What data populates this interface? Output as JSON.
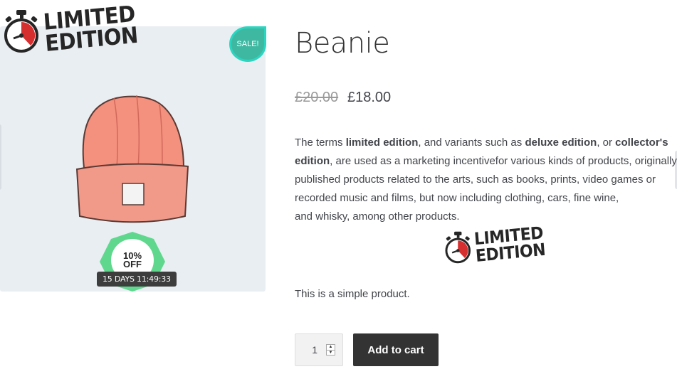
{
  "gallery": {
    "limited_badge_line1": "LIMITED",
    "limited_badge_line2": "EDITION",
    "sale_label": "SALE!",
    "discount_line1": "10%",
    "discount_line2": "OFF",
    "countdown": "15 DAYS 11:49:33"
  },
  "product": {
    "title": "Beanie",
    "price_old": "£20.00",
    "price_new": "£18.00",
    "description": {
      "p1": "The terms ",
      "b1": "limited edition",
      "p2": ", and variants such as ",
      "b2": "deluxe edition",
      "p3": ", or ",
      "b3": "collector's edition",
      "p4": ", are used as a marketing incentivefor various kinds of products, originally published products related to the arts, such as books, prints, video games or recorded music and films, but now including clothing, cars, fine wine,",
      "p5": "and whisky, among other products."
    },
    "inline_badge_line1": "LIMITED",
    "inline_badge_line2": "EDITION",
    "short_description": "This is a simple product.",
    "quantity": "1",
    "add_to_cart": "Add to cart"
  },
  "colors": {
    "sale": "#3fb8a2",
    "discount": "#5fd88e",
    "button": "#333333",
    "stopwatch_red": "#d62f2f"
  },
  "icons": [
    "stopwatch-icon",
    "beanie-image",
    "spinner-up-icon",
    "spinner-down-icon"
  ]
}
